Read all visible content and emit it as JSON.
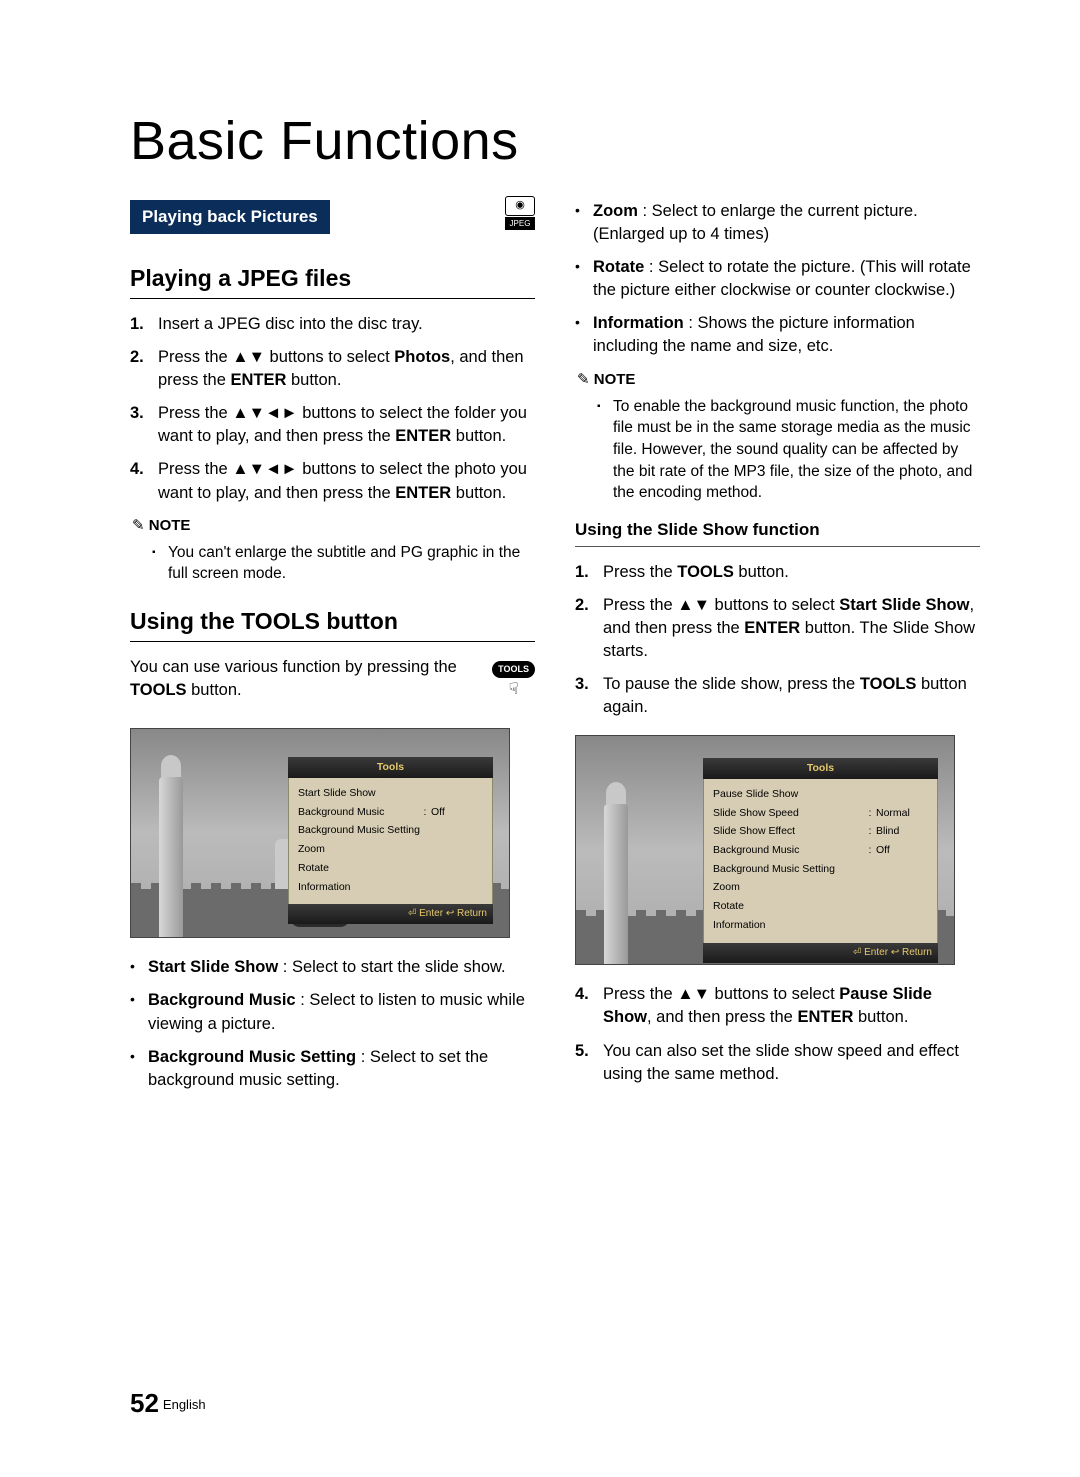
{
  "title": "Basic Functions",
  "banner": "Playing back Pictures",
  "jpeg_label": "JPEG",
  "left": {
    "h2a": "Playing a JPEG files",
    "steps_a": [
      {
        "num": "1.",
        "parts": [
          "Insert a JPEG disc into the disc tray."
        ]
      },
      {
        "num": "2.",
        "parts": [
          "Press the ▲▼ buttons to select ",
          "Photos",
          ", and then press the ",
          "ENTER",
          " button."
        ]
      },
      {
        "num": "3.",
        "parts": [
          "Press the ▲▼◄► buttons to select the folder you want to play, and then press the ",
          "ENTER",
          " button."
        ]
      },
      {
        "num": "4.",
        "parts": [
          "Press the ▲▼◄► buttons to select the photo you want to play, and then press the ",
          "ENTER",
          " button."
        ]
      }
    ],
    "note_head": "NOTE",
    "note_a": "You can't enlarge the subtitle and PG graphic in the full screen mode.",
    "h2b": "Using the TOOLS button",
    "intro_parts": [
      "You can use various function by pressing the ",
      "TOOLS",
      " button."
    ],
    "tools_label": "TOOLS",
    "menu1": {
      "title": "Tools",
      "rows": [
        {
          "k": "Start Slide Show"
        },
        {
          "k": "Background Music",
          "c": ":",
          "v": "Off"
        },
        {
          "k": "Background Music Setting"
        },
        {
          "k": "Zoom"
        },
        {
          "k": "Rotate"
        },
        {
          "k": "Information"
        }
      ],
      "foot": "⏎ Enter   ↩ Return"
    },
    "bullets": [
      {
        "b": "Start Slide Show",
        "rest": " : Select to start the slide show."
      },
      {
        "b": "Background Music",
        "rest": " : Select to listen to music while viewing a picture."
      },
      {
        "b": "Background Music Setting",
        "rest": " : Select to set the background music setting."
      }
    ]
  },
  "right": {
    "bullets_top": [
      {
        "b": "Zoom",
        "rest": " : Select to enlarge the current picture. (Enlarged up to 4 times)"
      },
      {
        "b": "Rotate",
        "rest": " : Select to rotate the picture. (This will rotate the picture either clockwise or counter clockwise.)"
      },
      {
        "b": "Information",
        "rest": " : Shows the picture information including the name and size, etc."
      }
    ],
    "note_head": "NOTE",
    "note_b": "To enable the background music function, the photo file must be in the same storage media as the music file. However, the sound quality can be affected by the bit rate of the MP3 file, the size of the photo, and the encoding method.",
    "h3": "Using the Slide Show function",
    "steps_b": [
      {
        "num": "1.",
        "parts": [
          "Press the ",
          "TOOLS",
          " button."
        ]
      },
      {
        "num": "2.",
        "parts": [
          "Press the ▲▼ buttons to select ",
          "Start Slide Show",
          ", and then press the ",
          "ENTER",
          " button. The Slide Show starts."
        ]
      },
      {
        "num": "3.",
        "parts": [
          "To pause the slide show, press the ",
          "TOOLS",
          " button again."
        ]
      }
    ],
    "menu2": {
      "title": "Tools",
      "rows": [
        {
          "k": "Pause Slide Show"
        },
        {
          "k": "Slide Show Speed",
          "c": ":",
          "v": "Normal"
        },
        {
          "k": "Slide Show Effect",
          "c": ":",
          "v": "Blind"
        },
        {
          "k": "Background Music",
          "c": ":",
          "v": "Off"
        },
        {
          "k": "Background Music Setting"
        },
        {
          "k": "Zoom"
        },
        {
          "k": "Rotate"
        },
        {
          "k": "Information"
        }
      ],
      "foot": "⏎ Enter   ↩ Return"
    },
    "steps_c": [
      {
        "num": "4.",
        "parts": [
          "Press the ▲▼ buttons to select ",
          "Pause Slide Show",
          ", and then press the ",
          "ENTER",
          " button."
        ]
      },
      {
        "num": "5.",
        "parts": [
          "You can also set the slide show speed and effect using the same method."
        ]
      }
    ]
  },
  "footer": {
    "page": "52",
    "lang": "English"
  }
}
